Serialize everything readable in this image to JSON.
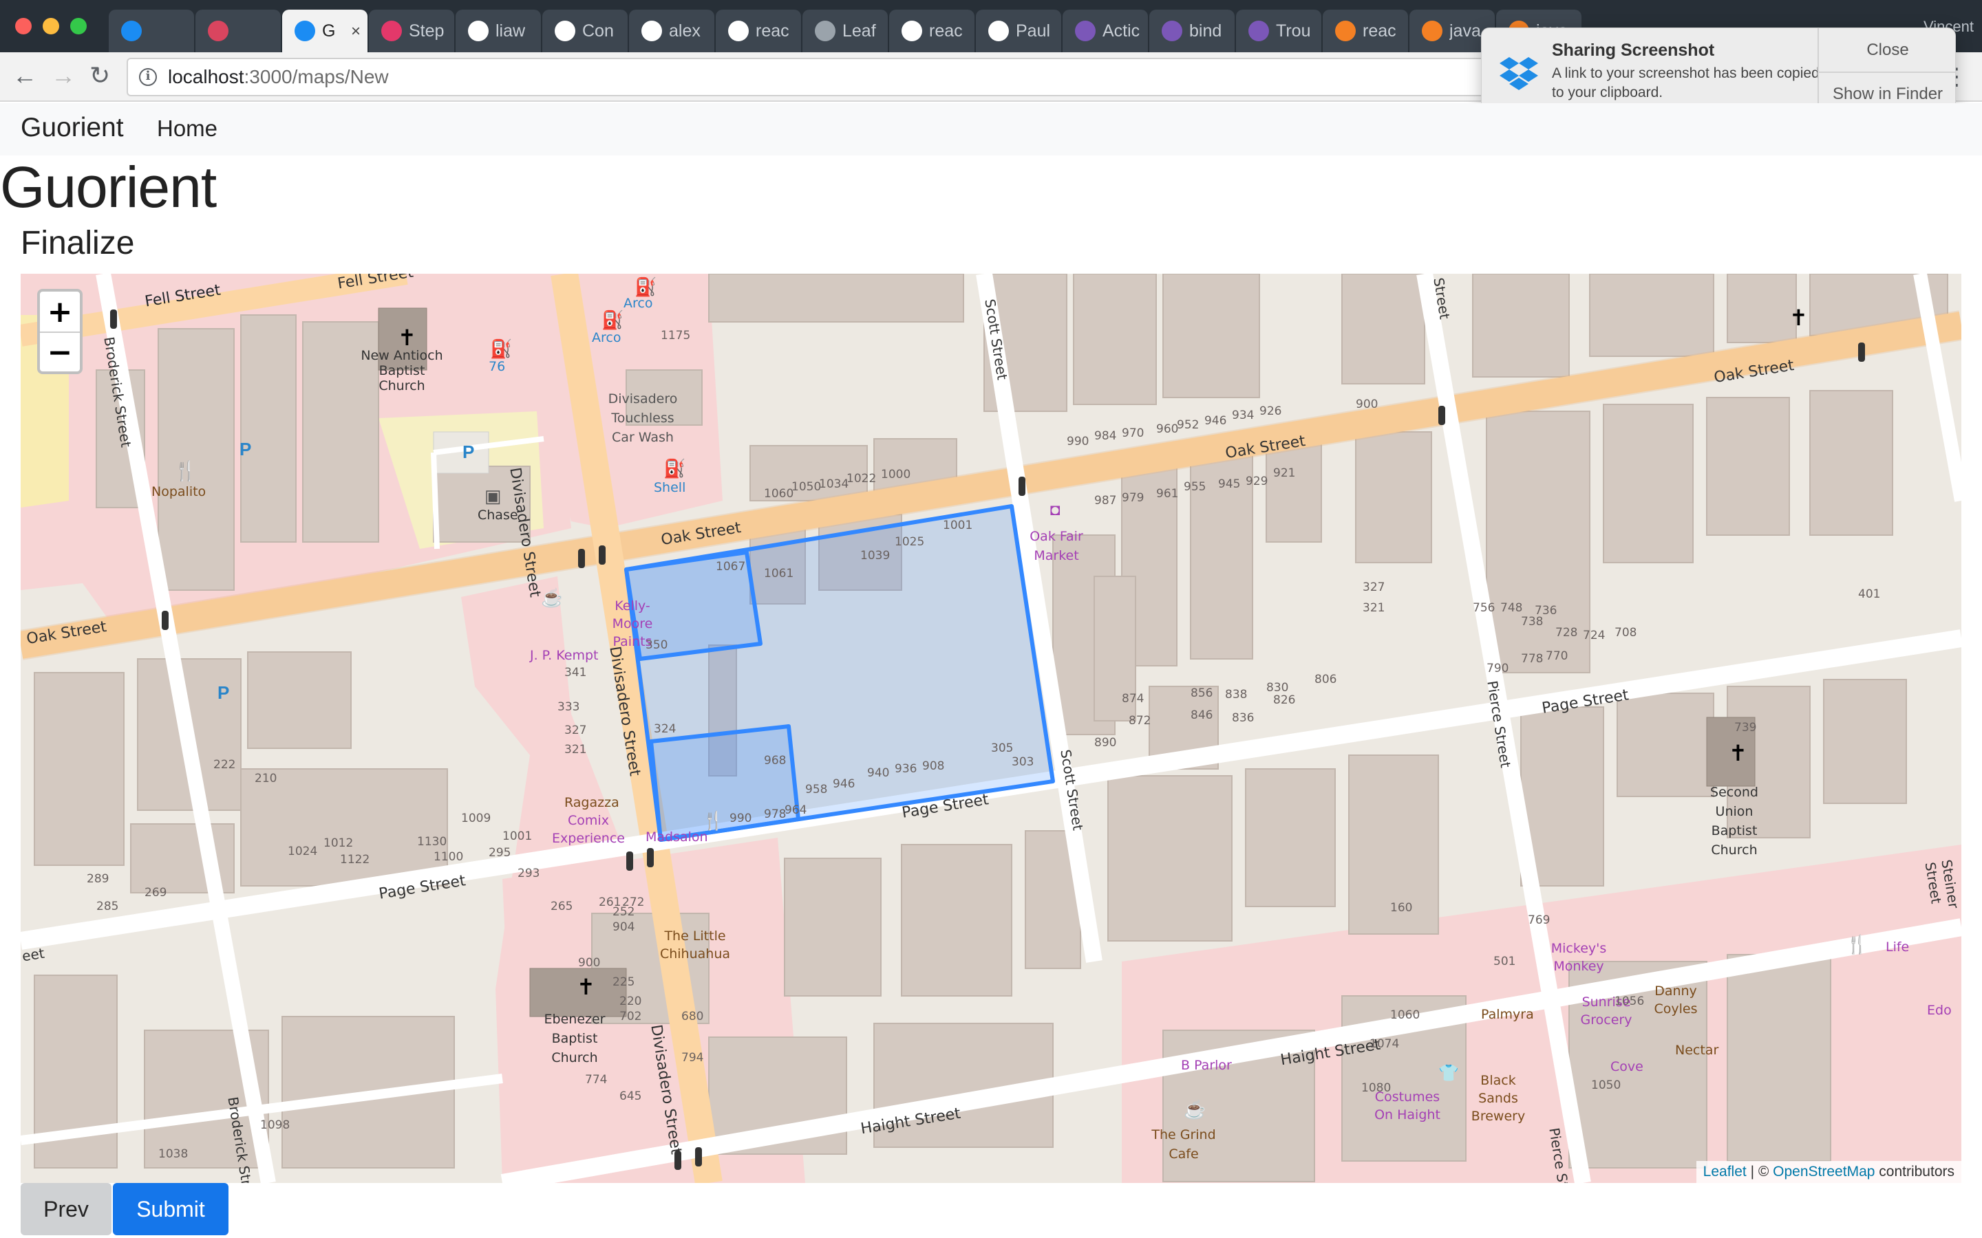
{
  "browser": {
    "tabs": [
      {
        "label": "",
        "icon": "messenger-icon",
        "color": "#1b8cf3"
      },
      {
        "label": "",
        "icon": "app-icon",
        "color": "#d9455f"
      },
      {
        "label": "G",
        "icon": "react-icon",
        "color": "#1b8cf3",
        "active": true
      },
      {
        "label": "Step",
        "icon": "invision-icon",
        "color": "#e3386a"
      },
      {
        "label": "liaw",
        "icon": "github-icon",
        "color": "#ffffff"
      },
      {
        "label": "Con",
        "icon": "github-icon",
        "color": "#ffffff"
      },
      {
        "label": "alex",
        "icon": "github-icon",
        "color": "#ffffff"
      },
      {
        "label": "reac",
        "icon": "github-icon",
        "color": "#ffffff"
      },
      {
        "label": "Leaf",
        "icon": "document-icon",
        "color": "#9aa3ab"
      },
      {
        "label": "reac",
        "icon": "github-icon",
        "color": "#ffffff"
      },
      {
        "label": "Paul",
        "icon": "github-icon",
        "color": "#ffffff"
      },
      {
        "label": "Actic",
        "icon": "redux-icon",
        "color": "#7b57b8"
      },
      {
        "label": "bind",
        "icon": "redux-icon",
        "color": "#7b57b8"
      },
      {
        "label": "Trou",
        "icon": "redux-icon",
        "color": "#7b57b8"
      },
      {
        "label": "reac",
        "icon": "stackoverflow-icon",
        "color": "#f48024"
      },
      {
        "label": "java",
        "icon": "stackoverflow-icon",
        "color": "#f48024"
      },
      {
        "label": "java",
        "icon": "stackoverflow-icon",
        "color": "#f48024"
      }
    ],
    "user": "Vincent",
    "url_host": "localhost",
    "url_path": ":3000/maps/New"
  },
  "notification": {
    "title": "Sharing Screenshot",
    "body": "A link to your screenshot has been copied to your clipboard.",
    "close_label": "Close",
    "finder_label": "Show in Finder"
  },
  "nav": {
    "brand": "Guorient",
    "home": "Home"
  },
  "page": {
    "title": "Guorient",
    "section": "Finalize"
  },
  "map": {
    "zoom_in": "+",
    "zoom_out": "−",
    "attribution_leaflet": "Leaflet",
    "attribution_sep": " | © ",
    "attribution_osm": "OpenStreetMap",
    "attribution_tail": " contributors",
    "streets": {
      "fell": "Fell Street",
      "oak": "Oak Street",
      "page": "Page Street",
      "haight": "Haight Street",
      "divisadero": "Divisadero Street",
      "scott": "Scott Street",
      "pierce": "Pierce Street",
      "broderick": "Broderick Street",
      "steiner": "Steiner Street",
      "street": "Street",
      "eet": "eet"
    },
    "pois": {
      "new_antioch": "New Antioch Baptist Church",
      "nopalito": "Nopalito",
      "chase": "Chase",
      "arco": "Arco",
      "seventy_six": "76",
      "car_wash": "Divisadero Touchless Car Wash",
      "shell": "Shell",
      "kelly_moore": "Kelly-Moore Paints",
      "jp_kempt": "J. P. Kempt",
      "oak_fair": "Oak Fair Market",
      "ragazza": "Ragazza",
      "comix": "Comix Experience",
      "madsalon": "Madsalon",
      "little_chihuahua": "The Little Chihuahua",
      "ebenezer": "Ebenezer Baptist Church",
      "second_union": "Second Union Baptist Church",
      "mickeys": "Mickey's Monkey",
      "sunrise": "Sunrise Grocery",
      "danny": "Danny Coyles",
      "palmyra": "Palmyra",
      "nectar": "Nectar",
      "cove": "Cove",
      "life": "Life",
      "edo": "Edo",
      "b_parlor": "B Parlor",
      "costumes": "Costumes On Haight",
      "black_sands": "Black Sands Brewery",
      "grind": "The Grind Cafe"
    },
    "house_numbers": [
      "1175",
      "1060",
      "1050",
      "1034",
      "1022",
      "1000",
      "990",
      "984",
      "970",
      "960",
      "952",
      "946",
      "934",
      "926",
      "900",
      "987",
      "979",
      "961",
      "955",
      "945",
      "929",
      "921",
      "1001",
      "1025",
      "1039",
      "1067",
      "1061",
      "350",
      "341",
      "333",
      "327",
      "321",
      "324",
      "968",
      "958",
      "946",
      "940",
      "936",
      "908",
      "305",
      "303",
      "990",
      "978",
      "964",
      "327",
      "321",
      "756",
      "748",
      "738",
      "736",
      "728",
      "724",
      "708",
      "401",
      "790",
      "778",
      "770",
      "874",
      "872",
      "856",
      "846",
      "838",
      "836",
      "830",
      "826",
      "806",
      "890",
      "739",
      "222",
      "210",
      "1098",
      "1080",
      "1074",
      "1060",
      "1056",
      "1050",
      "1038",
      "1024",
      "1012",
      "1122",
      "1130",
      "1100",
      "1009",
      "1001",
      "295",
      "293",
      "289",
      "285",
      "269",
      "265",
      "261",
      "272",
      "252",
      "904",
      "900",
      "225",
      "220",
      "702",
      "680",
      "794",
      "774",
      "645",
      "160",
      "769",
      "501"
    ],
    "selection_color": "#3388ff"
  },
  "buttons": {
    "prev": "Prev",
    "submit": "Submit"
  }
}
